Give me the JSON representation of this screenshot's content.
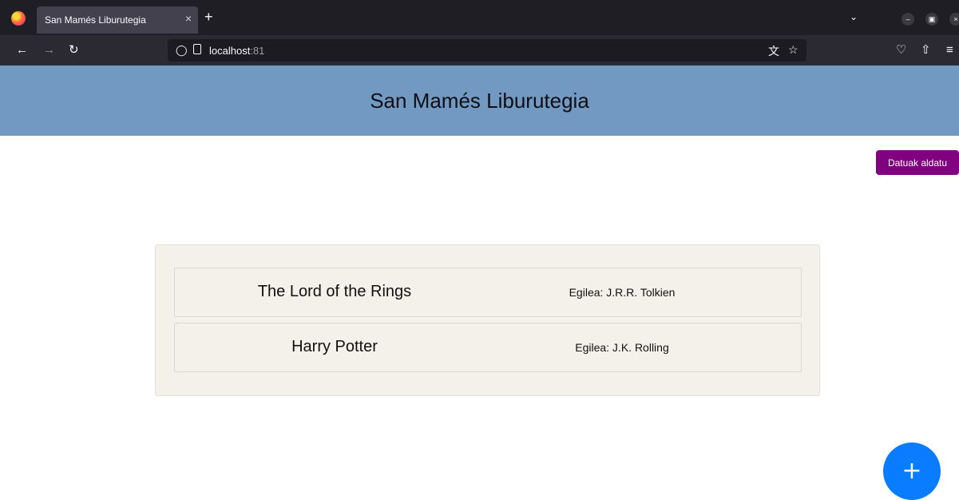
{
  "browser": {
    "tab_title": "San Mamés Liburutegia",
    "tab_close": "×",
    "new_tab": "+",
    "url_host": "localhost",
    "url_port": ":81",
    "icons": [
      "firefox-logo",
      "back-arrow",
      "forward-arrow",
      "reload",
      "shield",
      "page",
      "translate",
      "bookmark-star",
      "pocket",
      "extensions",
      "menu"
    ]
  },
  "header": {
    "title": "San Mamés Liburutegia",
    "background": "#7299c2"
  },
  "logout": {
    "label": "Datuak aldatu",
    "color": "#800080"
  },
  "books": [
    {
      "title": "The Lord of the Rings",
      "author": "Egilea: J.R.R. Tolkien"
    },
    {
      "title": "Harry Potter",
      "author": "Egilea: J.K. Rolling"
    }
  ],
  "fab": {
    "label": "+",
    "color": "#0a7cff"
  }
}
